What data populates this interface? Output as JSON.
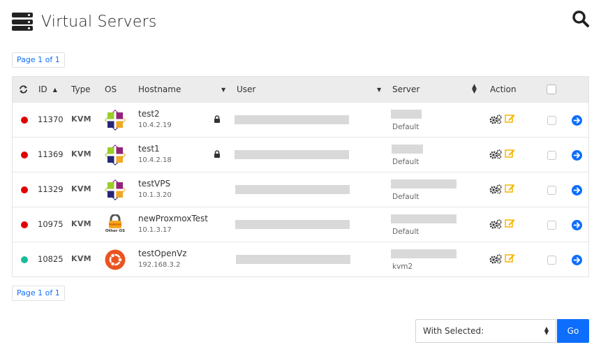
{
  "header": {
    "title": "Virtual Servers"
  },
  "pagination": {
    "top": "Page 1 of 1",
    "bottom": "Page 1 of 1"
  },
  "table": {
    "columns": {
      "refresh": "refresh-icon",
      "id": "ID",
      "type": "Type",
      "os": "OS",
      "hostname": "Hostname",
      "user": "User",
      "server": "Server",
      "action": "Action"
    },
    "rows": [
      {
        "status_color": "#e00000",
        "id": "11370",
        "type": "KVM",
        "os_icon": "centos-icon",
        "hostname": "test2",
        "ip": "10.4.2.19",
        "locked": true,
        "server": "Default"
      },
      {
        "status_color": "#e00000",
        "id": "11369",
        "type": "KVM",
        "os_icon": "centos-icon",
        "hostname": "test1",
        "ip": "10.4.2.18",
        "locked": true,
        "server": "Default"
      },
      {
        "status_color": "#e00000",
        "id": "11329",
        "type": "KVM",
        "os_icon": "centos-icon",
        "hostname": "testVPS",
        "ip": "10.1.3.20",
        "locked": false,
        "server": "Default"
      },
      {
        "status_color": "#e00000",
        "id": "10975",
        "type": "KVM",
        "os_icon": "other-os-icon",
        "os_label": "Other OS",
        "hostname": "newProxmoxTest",
        "ip": "10.1.3.17",
        "locked": false,
        "server": "Default"
      },
      {
        "status_color": "#1abc9c",
        "id": "10825",
        "type": "KVM",
        "os_icon": "ubuntu-icon",
        "hostname": "testOpenVz",
        "ip": "192.168.3.2",
        "locked": false,
        "server": "kvm2"
      }
    ]
  },
  "bulk_action": {
    "select_value": "With Selected:",
    "go_label": "Go"
  },
  "colors": {
    "accent": "#0d6efd",
    "edit": "#f5b400",
    "online": "#1abc9c",
    "offline": "#e00000"
  }
}
